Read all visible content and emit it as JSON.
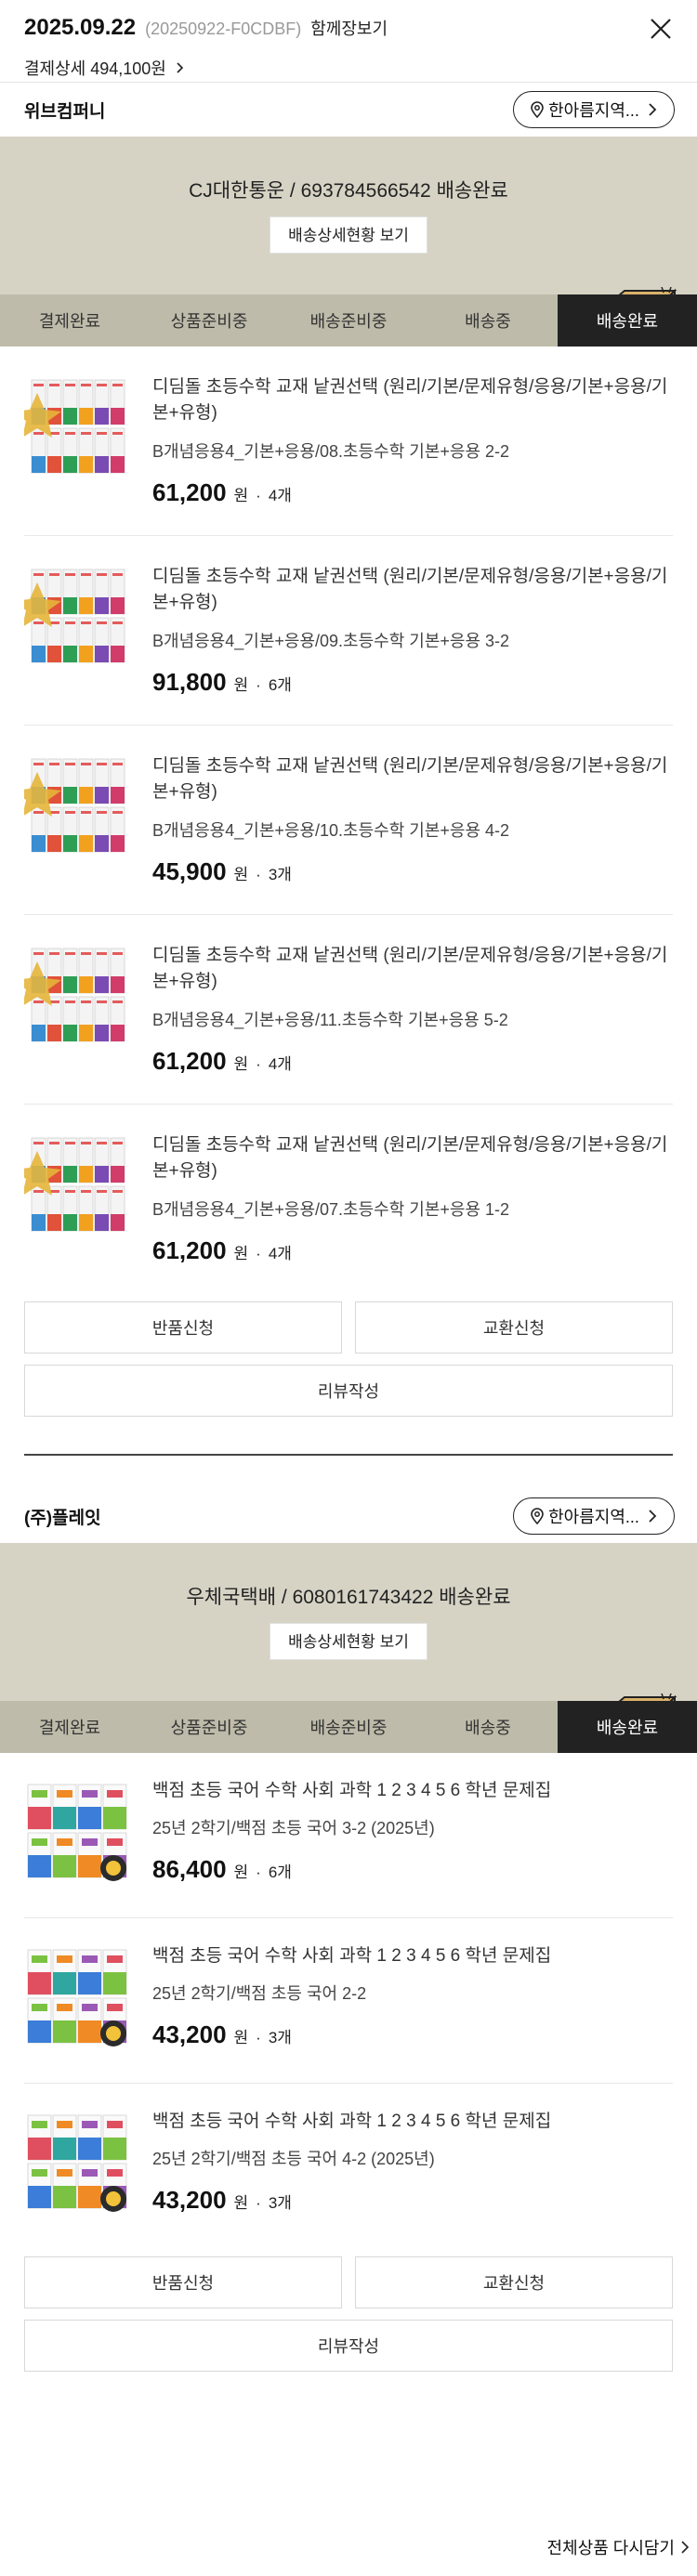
{
  "header": {
    "date": "2025.09.22",
    "order_no": "(20250922-F0CDBF)",
    "together_label": "함께장보기",
    "payment_detail": "결제상세 494,100원"
  },
  "sellers": [
    {
      "name": "위브컴퍼니",
      "region_label": "한아름지역...",
      "shipping_status": "CJ대한통운 / 693784566542 배송완료",
      "detail_button": "배송상세현황 보기",
      "steps": [
        "결제완료",
        "상품준비중",
        "배송준비중",
        "배송중",
        "배송완료"
      ],
      "active_step": 4,
      "items": [
        {
          "name": "디딤돌 초등수학 교재 낱권선택 (원리/기본/문제유형/응용/기본+응용/기본+유형)",
          "option": "B개념응용4_기본+응용/08.초등수학 기본+응용 2-2",
          "price": "61,200",
          "won": "원",
          "qty": "4개"
        },
        {
          "name": "디딤돌 초등수학 교재 낱권선택 (원리/기본/문제유형/응용/기본+응용/기본+유형)",
          "option": "B개념응용4_기본+응용/09.초등수학 기본+응용 3-2",
          "price": "91,800",
          "won": "원",
          "qty": "6개"
        },
        {
          "name": "디딤돌 초등수학 교재 낱권선택 (원리/기본/문제유형/응용/기본+응용/기본+유형)",
          "option": "B개념응용4_기본+응용/10.초등수학 기본+응용 4-2",
          "price": "45,900",
          "won": "원",
          "qty": "3개"
        },
        {
          "name": "디딤돌 초등수학 교재 낱권선택 (원리/기본/문제유형/응용/기본+응용/기본+유형)",
          "option": "B개념응용4_기본+응용/11.초등수학 기본+응용 5-2",
          "price": "61,200",
          "won": "원",
          "qty": "4개"
        },
        {
          "name": "디딤돌 초등수학 교재 낱권선택 (원리/기본/문제유형/응용/기본+응용/기본+유형)",
          "option": "B개념응용4_기본+응용/07.초등수학 기본+응용 1-2",
          "price": "61,200",
          "won": "원",
          "qty": "4개"
        }
      ],
      "return_label": "반품신청",
      "exchange_label": "교환신청",
      "review_label": "리뷰작성"
    },
    {
      "name": "(주)플레잇",
      "region_label": "한아름지역...",
      "shipping_status": "우체국택배 / 6080161743422 배송완료",
      "detail_button": "배송상세현황 보기",
      "steps": [
        "결제완료",
        "상품준비중",
        "배송준비중",
        "배송중",
        "배송완료"
      ],
      "active_step": 4,
      "items": [
        {
          "name": "백점 초등 국어 수학 사회 과학 1 2 3 4 5 6 학년 문제집",
          "option": "25년 2학기/백점 초등 국어 3-2 (2025년)",
          "price": "86,400",
          "won": "원",
          "qty": "6개"
        },
        {
          "name": "백점 초등 국어 수학 사회 과학 1 2 3 4 5 6 학년 문제집",
          "option": "25년 2학기/백점 초등 국어 2-2",
          "price": "43,200",
          "won": "원",
          "qty": "3개"
        },
        {
          "name": "백점 초등 국어 수학 사회 과학 1 2 3 4 5 6 학년 문제집",
          "option": "25년 2학기/백점 초등 국어 4-2 (2025년)",
          "price": "43,200",
          "won": "원",
          "qty": "3개"
        }
      ],
      "return_label": "반품신청",
      "exchange_label": "교환신청",
      "review_label": "리뷰작성"
    }
  ],
  "footer": {
    "reorder_all": "전체상품 다시담기"
  },
  "colors": {
    "banner_bg": "#d6d3c5",
    "step_bg": "#bfbbaa",
    "step_active": "#222222"
  }
}
